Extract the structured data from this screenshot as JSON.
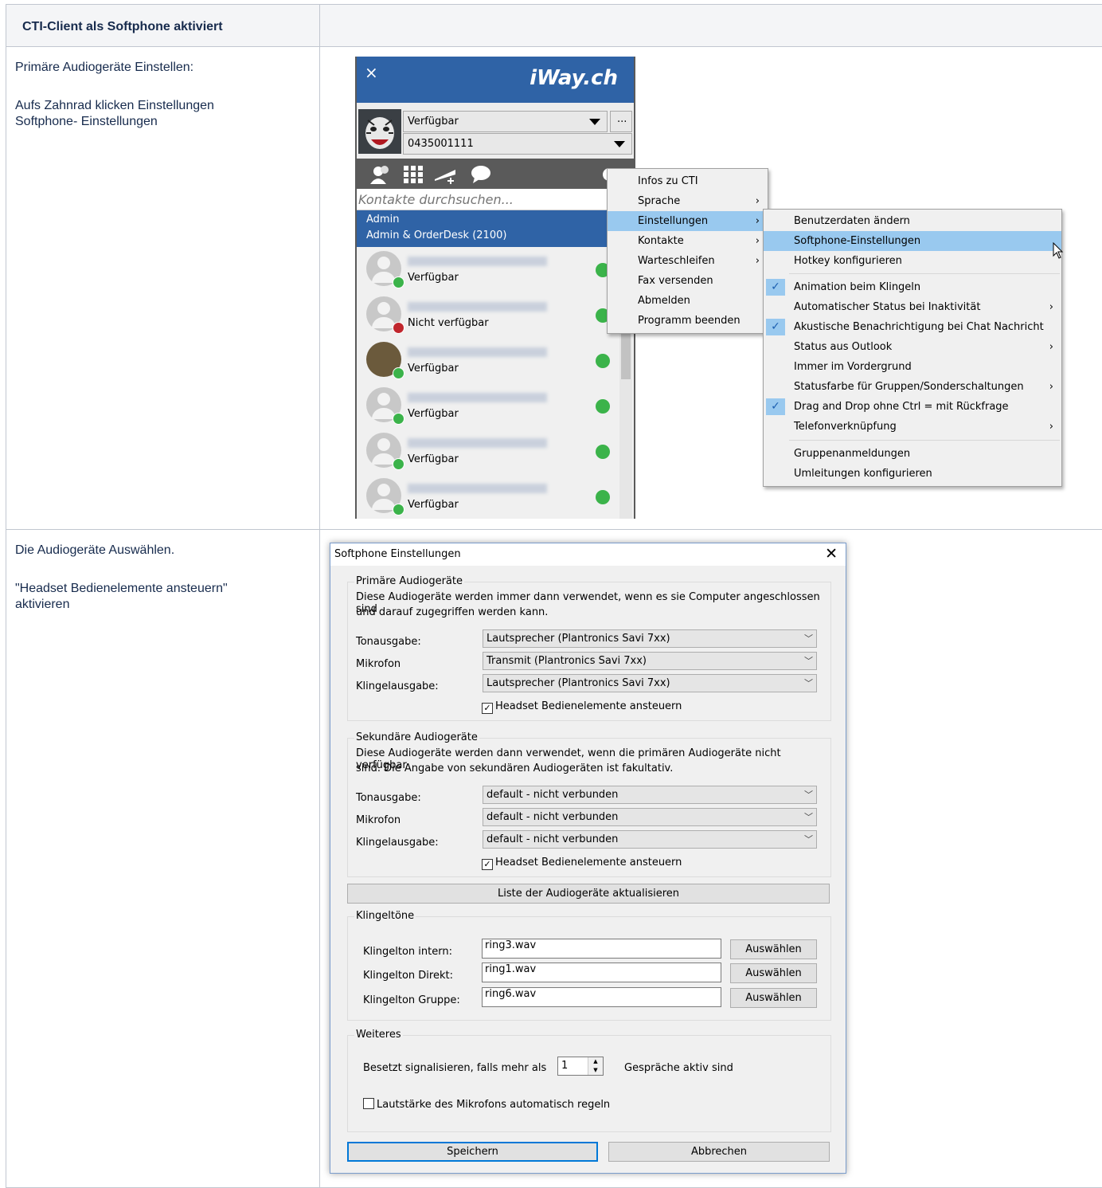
{
  "table": {
    "header": "CTI-Client als Softphone aktiviert",
    "row1": {
      "line1": "Primäre Audiogeräte Einstellen:",
      "line2": "Aufs Zahnrad klicken  Einstellungen",
      "line3": "Softphone- Einstellungen"
    },
    "row2": {
      "line1": "Die Audiogeräte Auswählen.",
      "line2": "\"Headset Bedienelemente ansteuern\"",
      "line3": "aktivieren"
    }
  },
  "cti": {
    "close": "×",
    "logo": "iWay.ch",
    "status": "Verfügbar",
    "more": "...",
    "number": "0435001111",
    "search_placeholder": "Kontakte durchsuchen...",
    "group_line1": "Admin",
    "group_line2": "Admin & OrderDesk (2100)",
    "contacts": [
      {
        "status": "Verfügbar",
        "color": "#3bb34a"
      },
      {
        "status": "Nicht verfügbar",
        "color": "#c0262d"
      },
      {
        "status": "Verfügbar",
        "color": "#3bb34a"
      },
      {
        "status": "Verfügbar",
        "color": "#3bb34a"
      },
      {
        "status": "Verfügbar",
        "color": "#3bb34a"
      },
      {
        "status": "Verfügbar",
        "color": "#3bb34a"
      }
    ]
  },
  "menu1": [
    {
      "label": "Infos zu  CTI",
      "sub": false
    },
    {
      "label": "Sprache",
      "sub": true
    },
    {
      "label": "Einstellungen",
      "sub": true,
      "highlight": true
    },
    {
      "label": "Kontakte",
      "sub": true
    },
    {
      "label": "Warteschleifen",
      "sub": true
    },
    {
      "label": "Fax versenden",
      "sub": false
    },
    {
      "label": "Abmelden",
      "sub": false
    },
    {
      "label": "Programm beenden",
      "sub": false
    }
  ],
  "menu2": [
    {
      "label": "Benutzerdaten ändern"
    },
    {
      "label": "Softphone-Einstellungen",
      "highlight": true
    },
    {
      "label": "Hotkey konfigurieren"
    },
    {
      "label": "Animation beim Klingeln",
      "checked": true
    },
    {
      "label": "Automatischer Status bei Inaktivität",
      "sub": true
    },
    {
      "label": "Akustische Benachrichtigung bei Chat Nachricht",
      "checked": true
    },
    {
      "label": "Status aus Outlook",
      "sub": true
    },
    {
      "label": "Immer im Vordergrund"
    },
    {
      "label": "Statusfarbe für Gruppen/Sonderschaltungen",
      "sub": true
    },
    {
      "label": "Drag and Drop ohne Ctrl = mit Rückfrage",
      "checked": true
    },
    {
      "label": "Telefonverknüpfung",
      "sub": true
    },
    {
      "label": "Gruppenanmeldungen"
    },
    {
      "label": "Umleitungen konfigurieren"
    }
  ],
  "dialog": {
    "title": "Softphone Einstellungen",
    "close": "✕",
    "primary": {
      "legend": "Primäre Audiogeräte",
      "desc1": "Diese Audiogeräte werden immer dann verwendet, wenn es sie Computer angeschlossen sind",
      "desc2": "und darauf zugegriffen werden kann.",
      "ton_label": "Tonausgabe:",
      "ton_value": "Lautsprecher (Plantronics Savi 7xx)",
      "mic_label": "Mikrofon",
      "mic_value": "Transmit (Plantronics Savi 7xx)",
      "ring_label": "Klingelausgabe:",
      "ring_value": "Lautsprecher (Plantronics Savi 7xx)",
      "headset": "Headset Bedienelemente ansteuern"
    },
    "secondary": {
      "legend": "Sekundäre Audiogeräte",
      "desc1": "Diese Audiogeräte werden dann verwendet, wenn die primären Audiogeräte nicht verfügbar",
      "desc2": "sind. Die Angabe von sekundären Audiogeräten ist fakultativ.",
      "ton_label": "Tonausgabe:",
      "ton_value": "default - nicht verbunden",
      "mic_label": "Mikrofon",
      "mic_value": "default - nicht verbunden",
      "ring_label": "Klingelausgabe:",
      "ring_value": "default - nicht verbunden",
      "headset": "Headset Bedienelemente ansteuern"
    },
    "refresh": "Liste der Audiogeräte aktualisieren",
    "ringtones": {
      "legend": "Klingeltöne",
      "intern_label": "Klingelton intern:",
      "intern_value": "ring3.wav",
      "direkt_label": "Klingelton Direkt:",
      "direkt_value": "ring1.wav",
      "gruppe_label": "Klingelton Gruppe:",
      "gruppe_value": "ring6.wav",
      "choose": "Auswählen"
    },
    "more": {
      "legend": "Weiteres",
      "busy_label": "Besetzt signalisieren, falls mehr als",
      "busy_value": "1",
      "busy_suffix": "Gespräche aktiv sind",
      "mic_auto": "Lautstärke des Mikrofons automatisch regeln"
    },
    "save": "Speichern",
    "cancel": "Abbrechen"
  }
}
